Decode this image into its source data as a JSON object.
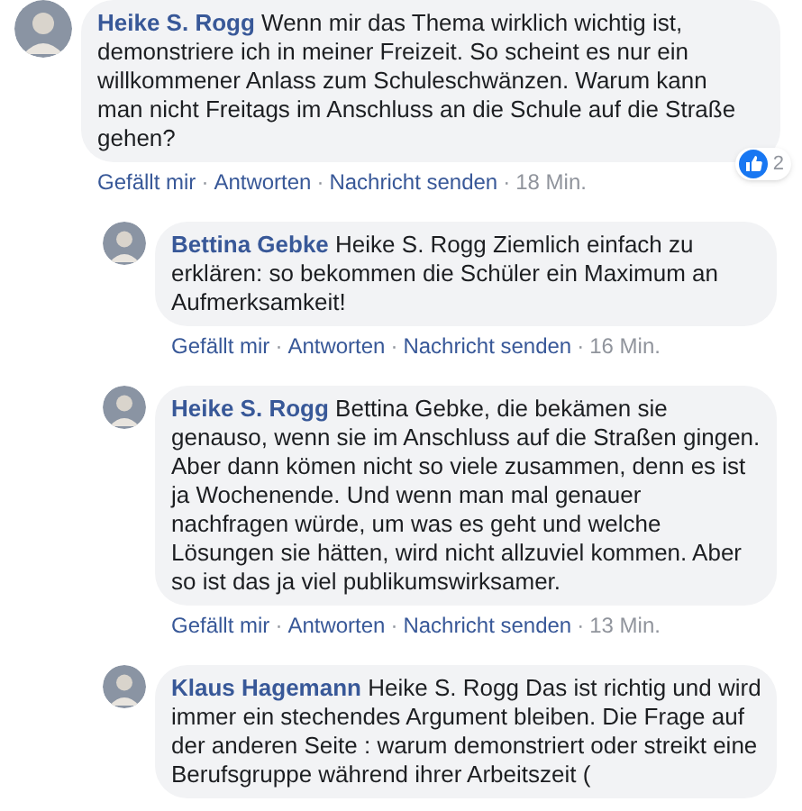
{
  "comments": [
    {
      "kind": "top",
      "name": "Heike S. Rogg",
      "text": "Wenn mir das Thema wirklich wichtig ist, demonstriere ich in meiner Freizeit. So scheint es nur ein willkommener Anlass zum Schuleschwänzen. Warum kann man nicht Freitags im Anschluss an die Schule auf die Straße gehen?",
      "actions": [
        "Gefällt mir",
        "·",
        "Antworten",
        "·",
        "Nachricht senden",
        "·"
      ],
      "time": "18 Min.",
      "reactions": "2"
    },
    {
      "kind": "reply",
      "name": "Bettina Gebke",
      "text": "Heike S. Rogg Ziemlich einfach zu erklären: so bekommen die Schüler ein Maximum an Aufmerksamkeit!",
      "actions": [
        "Gefällt mir",
        "·",
        "Antworten",
        "·",
        "Nachricht senden",
        "·"
      ],
      "time": "16 Min."
    },
    {
      "kind": "reply",
      "name": "Heike S. Rogg",
      "text": "Bettina Gebke, die bekämen sie genauso, wenn sie im Anschluss auf die Straßen gingen. Aber dann kömen nicht so viele zusammen, denn es ist ja Wochenende. Und wenn man mal genauer nachfragen würde, um was es geht und welche Lösungen sie hätten, wird nicht allzuviel kommen. Aber so ist das ja viel publikumswirksamer.",
      "actions": [
        "Gefällt mir",
        "·",
        "Antworten",
        "·",
        "Nachricht senden",
        "·"
      ],
      "time": "13 Min."
    },
    {
      "kind": "reply",
      "name": "Klaus Hagemann",
      "text": "Heike S. Rogg Das ist richtig und wird immer ein stechendes Argument bleiben. Die Frage auf der anderen Seite : warum demonstriert oder streikt eine Berufsgruppe während ihrer Arbeitszeit ("
    }
  ]
}
